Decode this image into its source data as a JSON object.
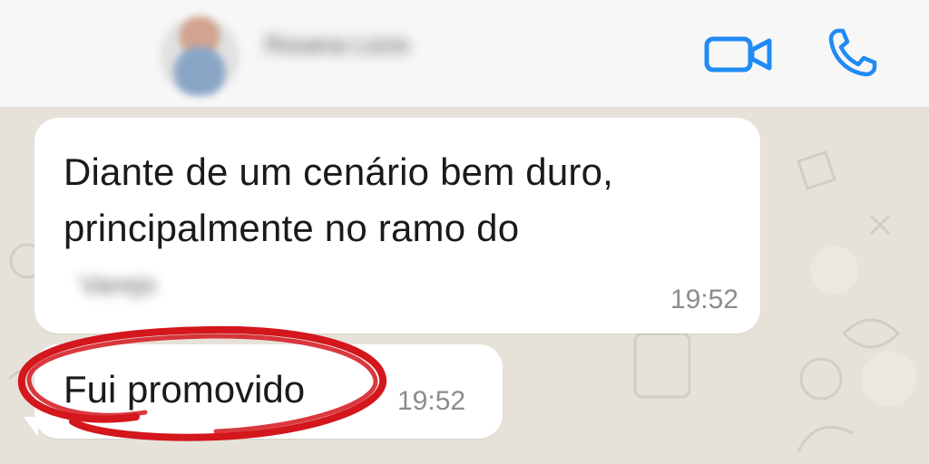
{
  "header": {
    "contact_name": "Rosana Lúcio",
    "video_icon": "video-camera-icon",
    "phone_icon": "phone-icon",
    "accent_color": "#1f8bf5"
  },
  "messages": [
    {
      "line1": "Diante de um cenário bem duro,",
      "line2": "principalmente no ramo do",
      "line3": "Varejo",
      "time": "19:52"
    },
    {
      "text": "Fui promovido",
      "time": "19:52"
    }
  ],
  "annotation": {
    "color": "#d4161d"
  }
}
